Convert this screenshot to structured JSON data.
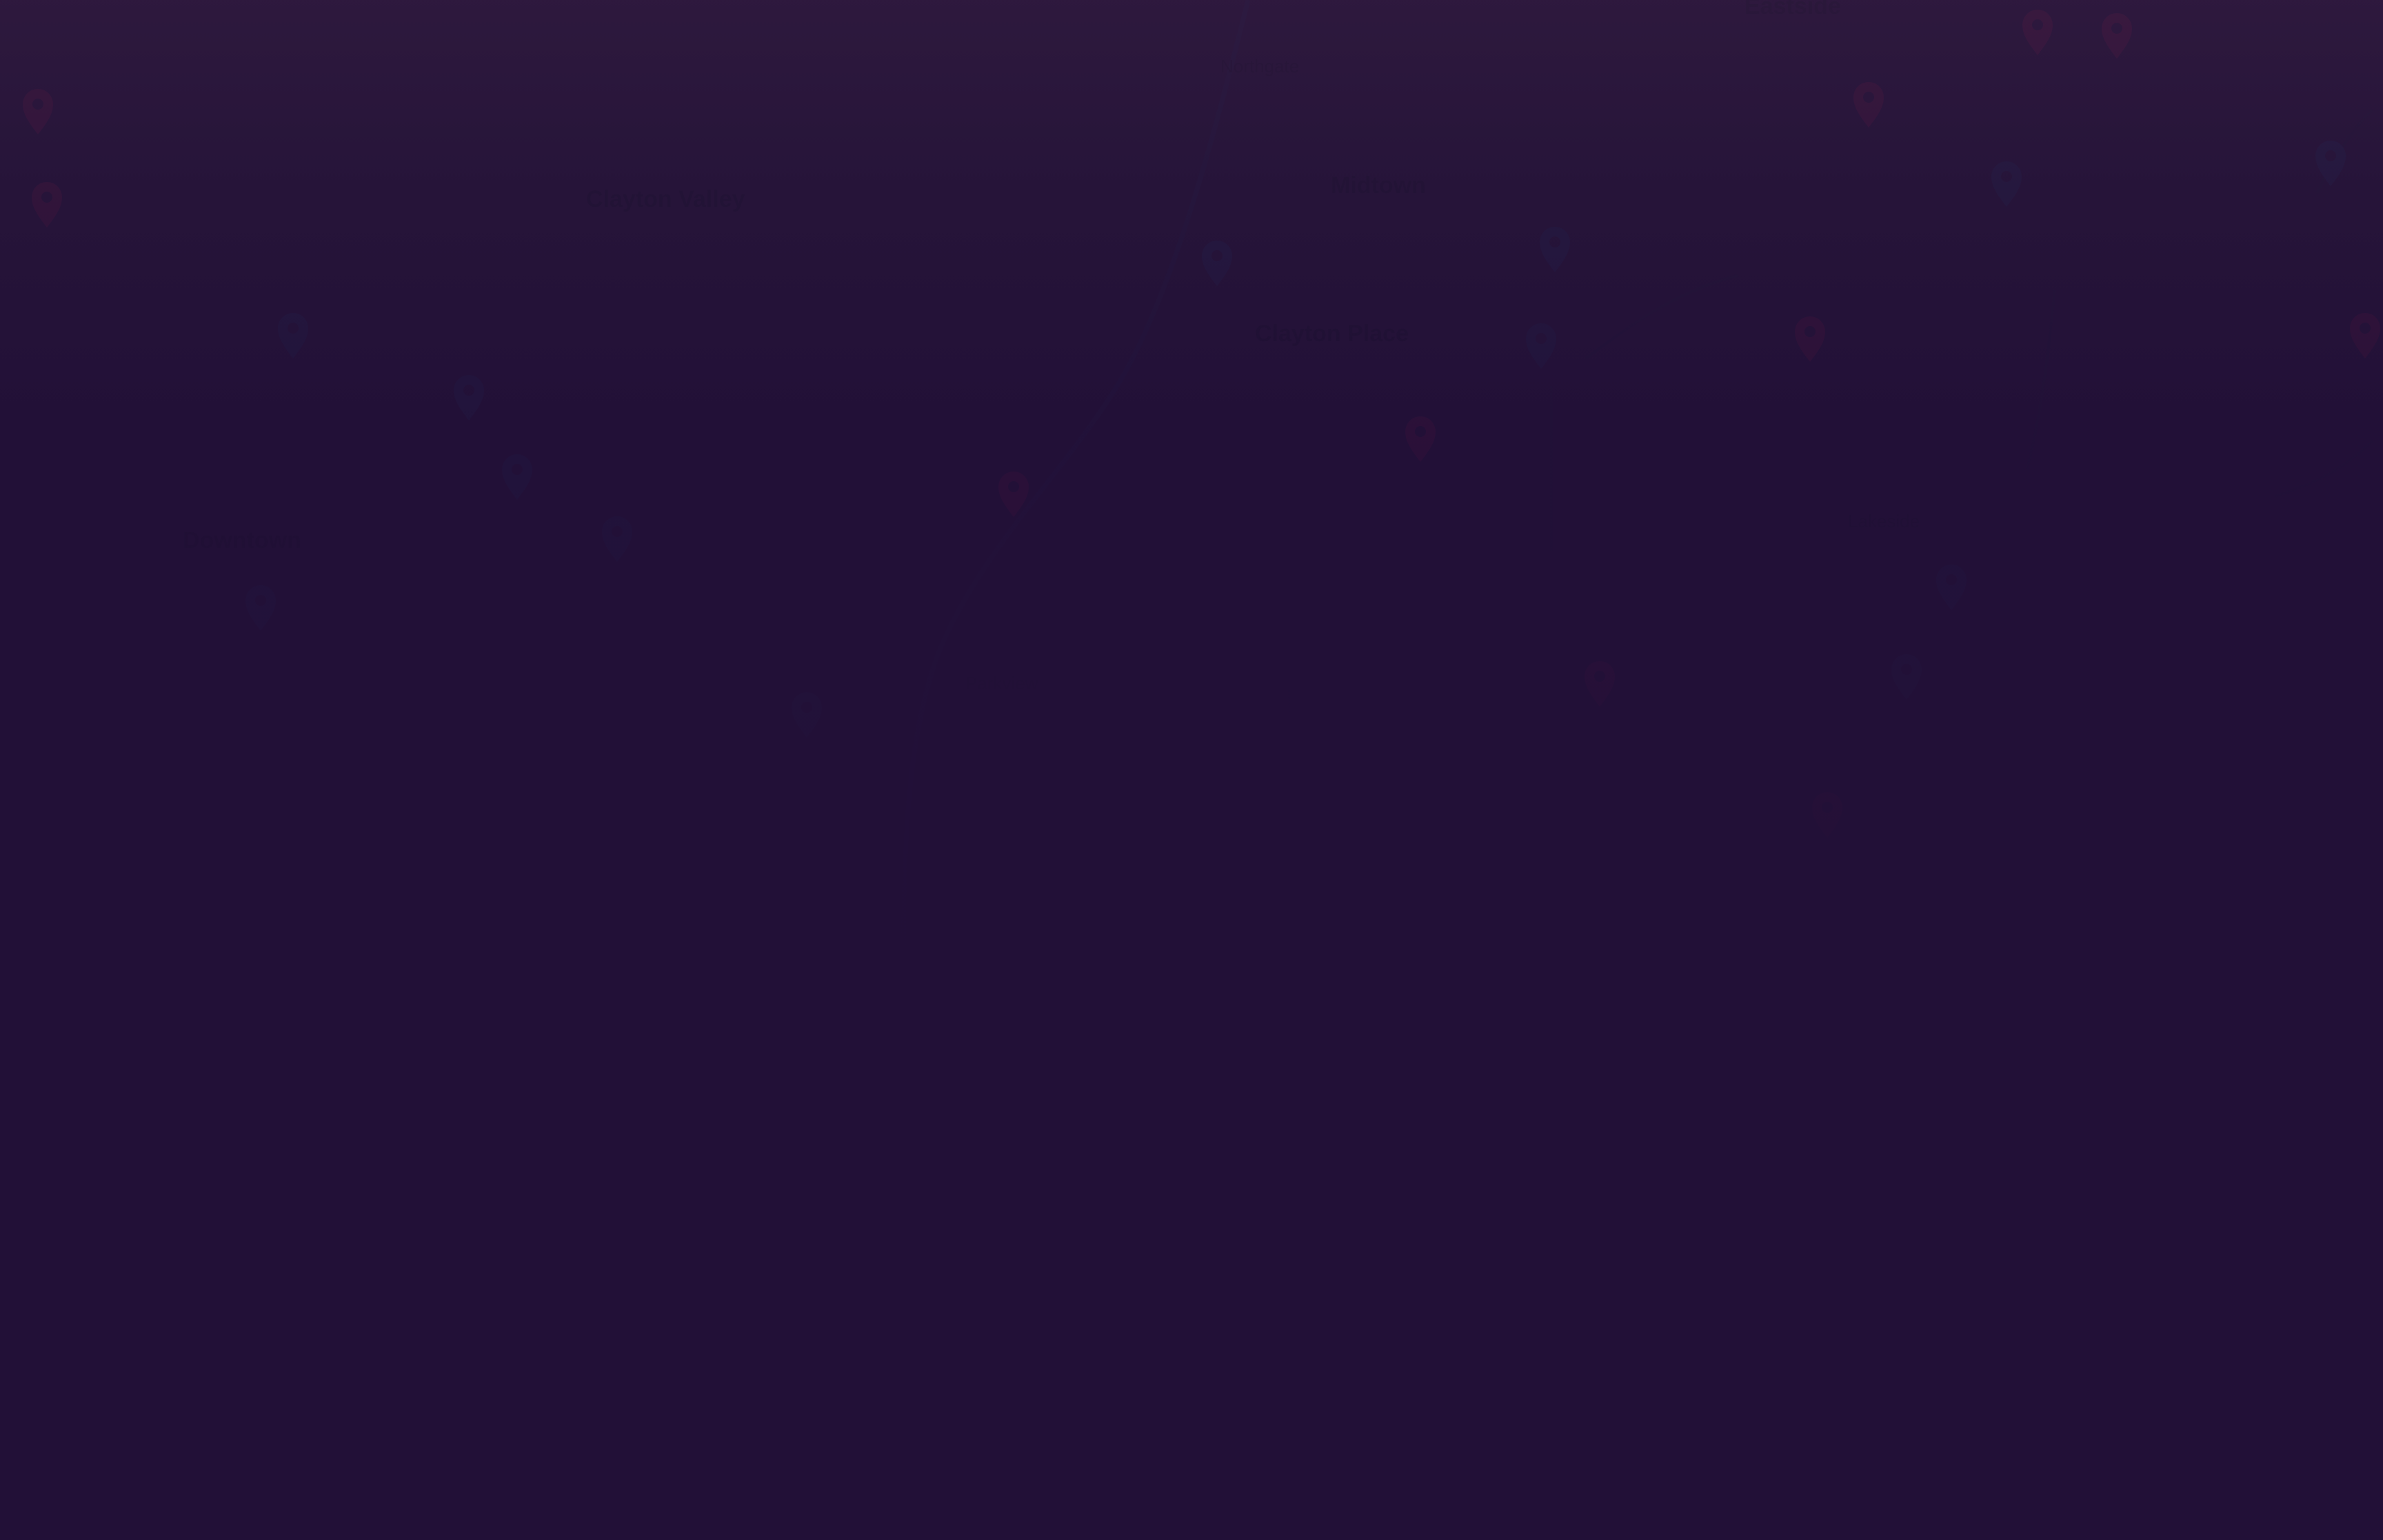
{
  "colors": {
    "background": "#221037",
    "pin_red": "#6b1440",
    "pin_blue": "#1c2a5a",
    "road": "#1e1c48"
  },
  "map": {
    "district_labels": [
      {
        "id": "a",
        "text": "Clayton Valley"
      },
      {
        "id": "b",
        "text": "Clayton Place"
      },
      {
        "id": "c",
        "text": "Downtown"
      },
      {
        "id": "d",
        "text": "Midtown"
      },
      {
        "id": "e",
        "text": "Eastside"
      },
      {
        "id": "f",
        "text": "Parkview"
      },
      {
        "id": "g",
        "text": "Lakeside"
      },
      {
        "id": "h",
        "text": "Northgate"
      }
    ],
    "pins": [
      {
        "id": "p1",
        "color": "red",
        "icon": "map-pin-icon"
      },
      {
        "id": "p2",
        "color": "red",
        "icon": "map-pin-icon"
      },
      {
        "id": "p3",
        "color": "blue",
        "icon": "map-pin-icon"
      },
      {
        "id": "p4",
        "color": "blue",
        "icon": "map-pin-icon"
      },
      {
        "id": "p5",
        "color": "blue",
        "icon": "map-pin-icon"
      },
      {
        "id": "p6",
        "color": "blue",
        "icon": "map-pin-icon"
      },
      {
        "id": "p7",
        "color": "blue",
        "icon": "map-pin-icon"
      },
      {
        "id": "p8",
        "color": "red",
        "icon": "map-pin-icon"
      },
      {
        "id": "p9",
        "color": "blue",
        "icon": "map-pin-icon"
      },
      {
        "id": "p10",
        "color": "blue",
        "icon": "map-pin-icon"
      },
      {
        "id": "p11",
        "color": "red",
        "icon": "map-pin-icon"
      },
      {
        "id": "p12",
        "color": "red",
        "icon": "map-pin-icon"
      },
      {
        "id": "p13",
        "color": "blue",
        "icon": "map-pin-icon"
      },
      {
        "id": "p14",
        "color": "red",
        "icon": "map-pin-icon"
      },
      {
        "id": "p15",
        "color": "red",
        "icon": "map-pin-icon"
      },
      {
        "id": "p16",
        "color": "blue",
        "icon": "map-pin-icon"
      },
      {
        "id": "p17",
        "color": "red",
        "icon": "map-pin-icon"
      },
      {
        "id": "p18",
        "color": "red",
        "icon": "map-pin-icon"
      },
      {
        "id": "p19",
        "color": "blue",
        "icon": "map-pin-icon"
      },
      {
        "id": "p20",
        "color": "red",
        "icon": "map-pin-icon"
      },
      {
        "id": "p21",
        "color": "blue",
        "icon": "map-pin-icon"
      },
      {
        "id": "p22",
        "color": "blue",
        "icon": "map-pin-icon"
      },
      {
        "id": "p23",
        "color": "red",
        "icon": "map-pin-icon"
      },
      {
        "id": "p24",
        "color": "blue",
        "icon": "map-pin-icon"
      }
    ]
  }
}
